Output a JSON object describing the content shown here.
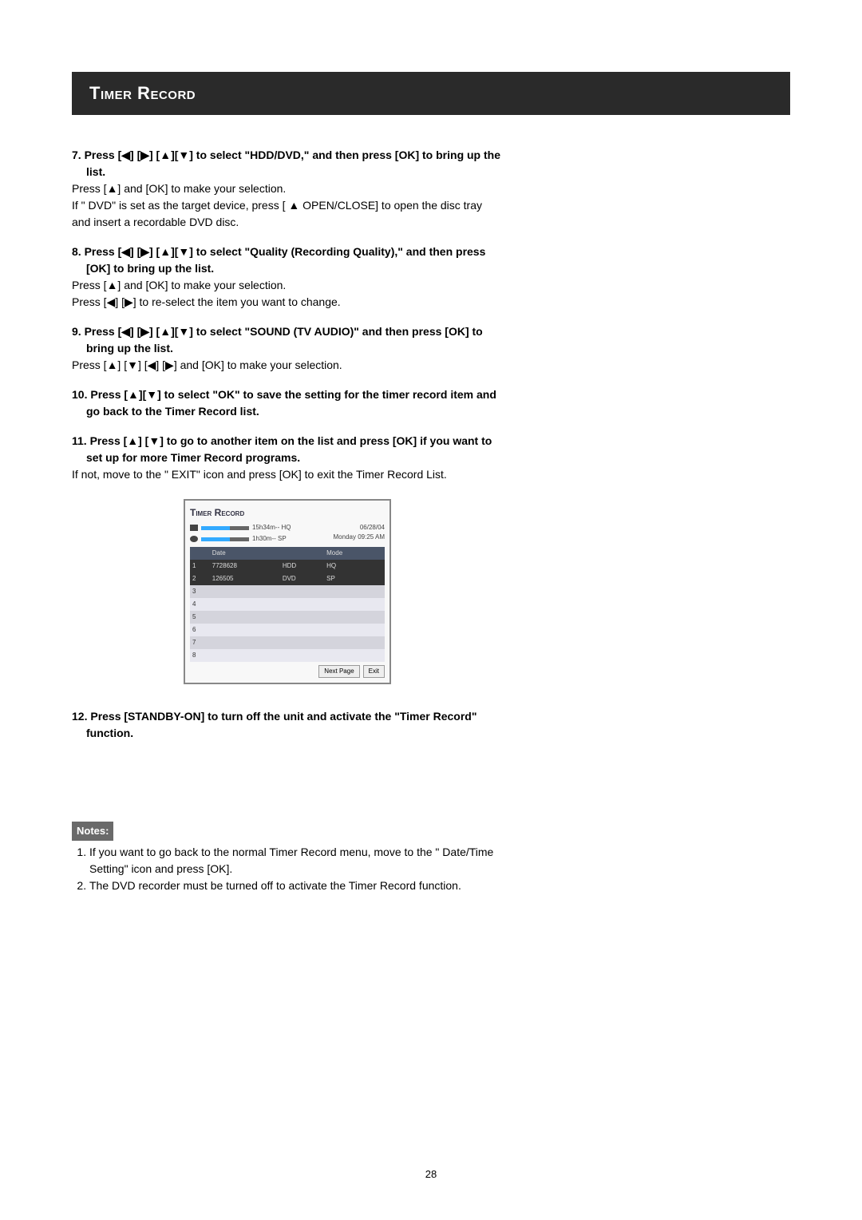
{
  "header": {
    "title": "Timer Record"
  },
  "steps": {
    "s7": {
      "title": "7.  Press [◀] [▶] [▲][▼] to select \"HDD/DVD,\" and then press [OK] to bring up the list.",
      "body1": "Press [▲] and [OK] to make your selection.",
      "body2": "If \" DVD\"  is set as the target device, press [ ▲ OPEN/CLOSE] to open the disc tray and insert a recordable DVD disc."
    },
    "s8": {
      "title": "8.  Press [◀] [▶] [▲][▼] to select \"Quality (Recording Quality),\" and then press [OK] to bring up the list.",
      "body1": "Press [▲] and [OK] to make your selection.",
      "body2": "Press [◀] [▶]  to re-select the item you want to change."
    },
    "s9": {
      "title": "9.   Press [◀] [▶] [▲][▼] to select \"SOUND (TV AUDIO)\" and then press [OK] to bring up the list.",
      "body1": "Press [▲] [▼] [◀] [▶] and [OK] to make your selection."
    },
    "s10": {
      "title": "10. Press [▲][▼] to select \"OK\" to save the setting for the timer record item and go back  to the Timer Record list."
    },
    "s11": {
      "title": "11. Press [▲] [▼] to go to another item on the list and press [OK] if you want to set up for more Timer Record programs.",
      "body1": "If not, move to the \" EXIT\"  icon and press [OK] to exit the Timer Record List."
    },
    "s12": {
      "title": "12. Press [STANDBY-ON] to turn off the unit and activate the \"Timer Record\" function."
    }
  },
  "screenshot": {
    "title": "Timer Record",
    "meter1": "15h34m-- HQ",
    "meter2": "1h30m-- SP",
    "date": "06/28/04",
    "daytime": "Monday   09:25 AM",
    "headers": [
      "",
      "Date",
      "",
      "Mode",
      ""
    ],
    "rows": [
      [
        "1",
        "7728628",
        "HDD",
        "HQ",
        ""
      ],
      [
        "2",
        "126505",
        "DVD",
        "SP",
        ""
      ],
      [
        "3",
        "",
        "",
        "",
        ""
      ],
      [
        "4",
        "",
        "",
        "",
        ""
      ],
      [
        "5",
        "",
        "",
        "",
        ""
      ],
      [
        "6",
        "",
        "",
        "",
        ""
      ],
      [
        "7",
        "",
        "",
        "",
        ""
      ],
      [
        "8",
        "",
        "",
        "",
        ""
      ]
    ],
    "btn_next": "Next Page",
    "btn_exit": "Exit"
  },
  "notes": {
    "label": "Notes:",
    "item1": "If you want to go back to the normal Timer Record menu, move to the \" Date/Time Setting\"  icon and press [OK].",
    "item2": "The DVD recorder must be turned off to activate the Timer Record function."
  },
  "page_number": "28"
}
